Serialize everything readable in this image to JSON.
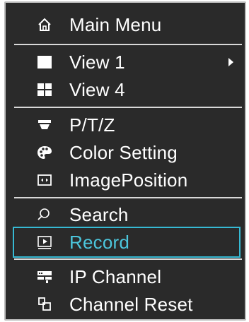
{
  "menu": {
    "items": [
      {
        "label": "Main Menu",
        "icon": "home-icon"
      },
      {
        "label": "View 1",
        "icon": "single-square-icon",
        "has_submenu": true
      },
      {
        "label": "View 4",
        "icon": "quad-grid-icon"
      },
      {
        "label": "P/T/Z",
        "icon": "ptz-camera-icon"
      },
      {
        "label": "Color Setting",
        "icon": "palette-icon"
      },
      {
        "label": "ImagePosition",
        "icon": "image-position-icon"
      },
      {
        "label": "Search",
        "icon": "search-icon"
      },
      {
        "label": "Record",
        "icon": "record-icon",
        "selected": true
      },
      {
        "label": "IP Channel",
        "icon": "ip-channel-icon"
      },
      {
        "label": "Channel Reset",
        "icon": "channel-reset-icon"
      }
    ]
  },
  "colors": {
    "background": "#2a2a2a",
    "text": "#ffffff",
    "selection": "#36b9d3",
    "selected_text": "#4cc6dc",
    "border": "#bdbdbd"
  }
}
